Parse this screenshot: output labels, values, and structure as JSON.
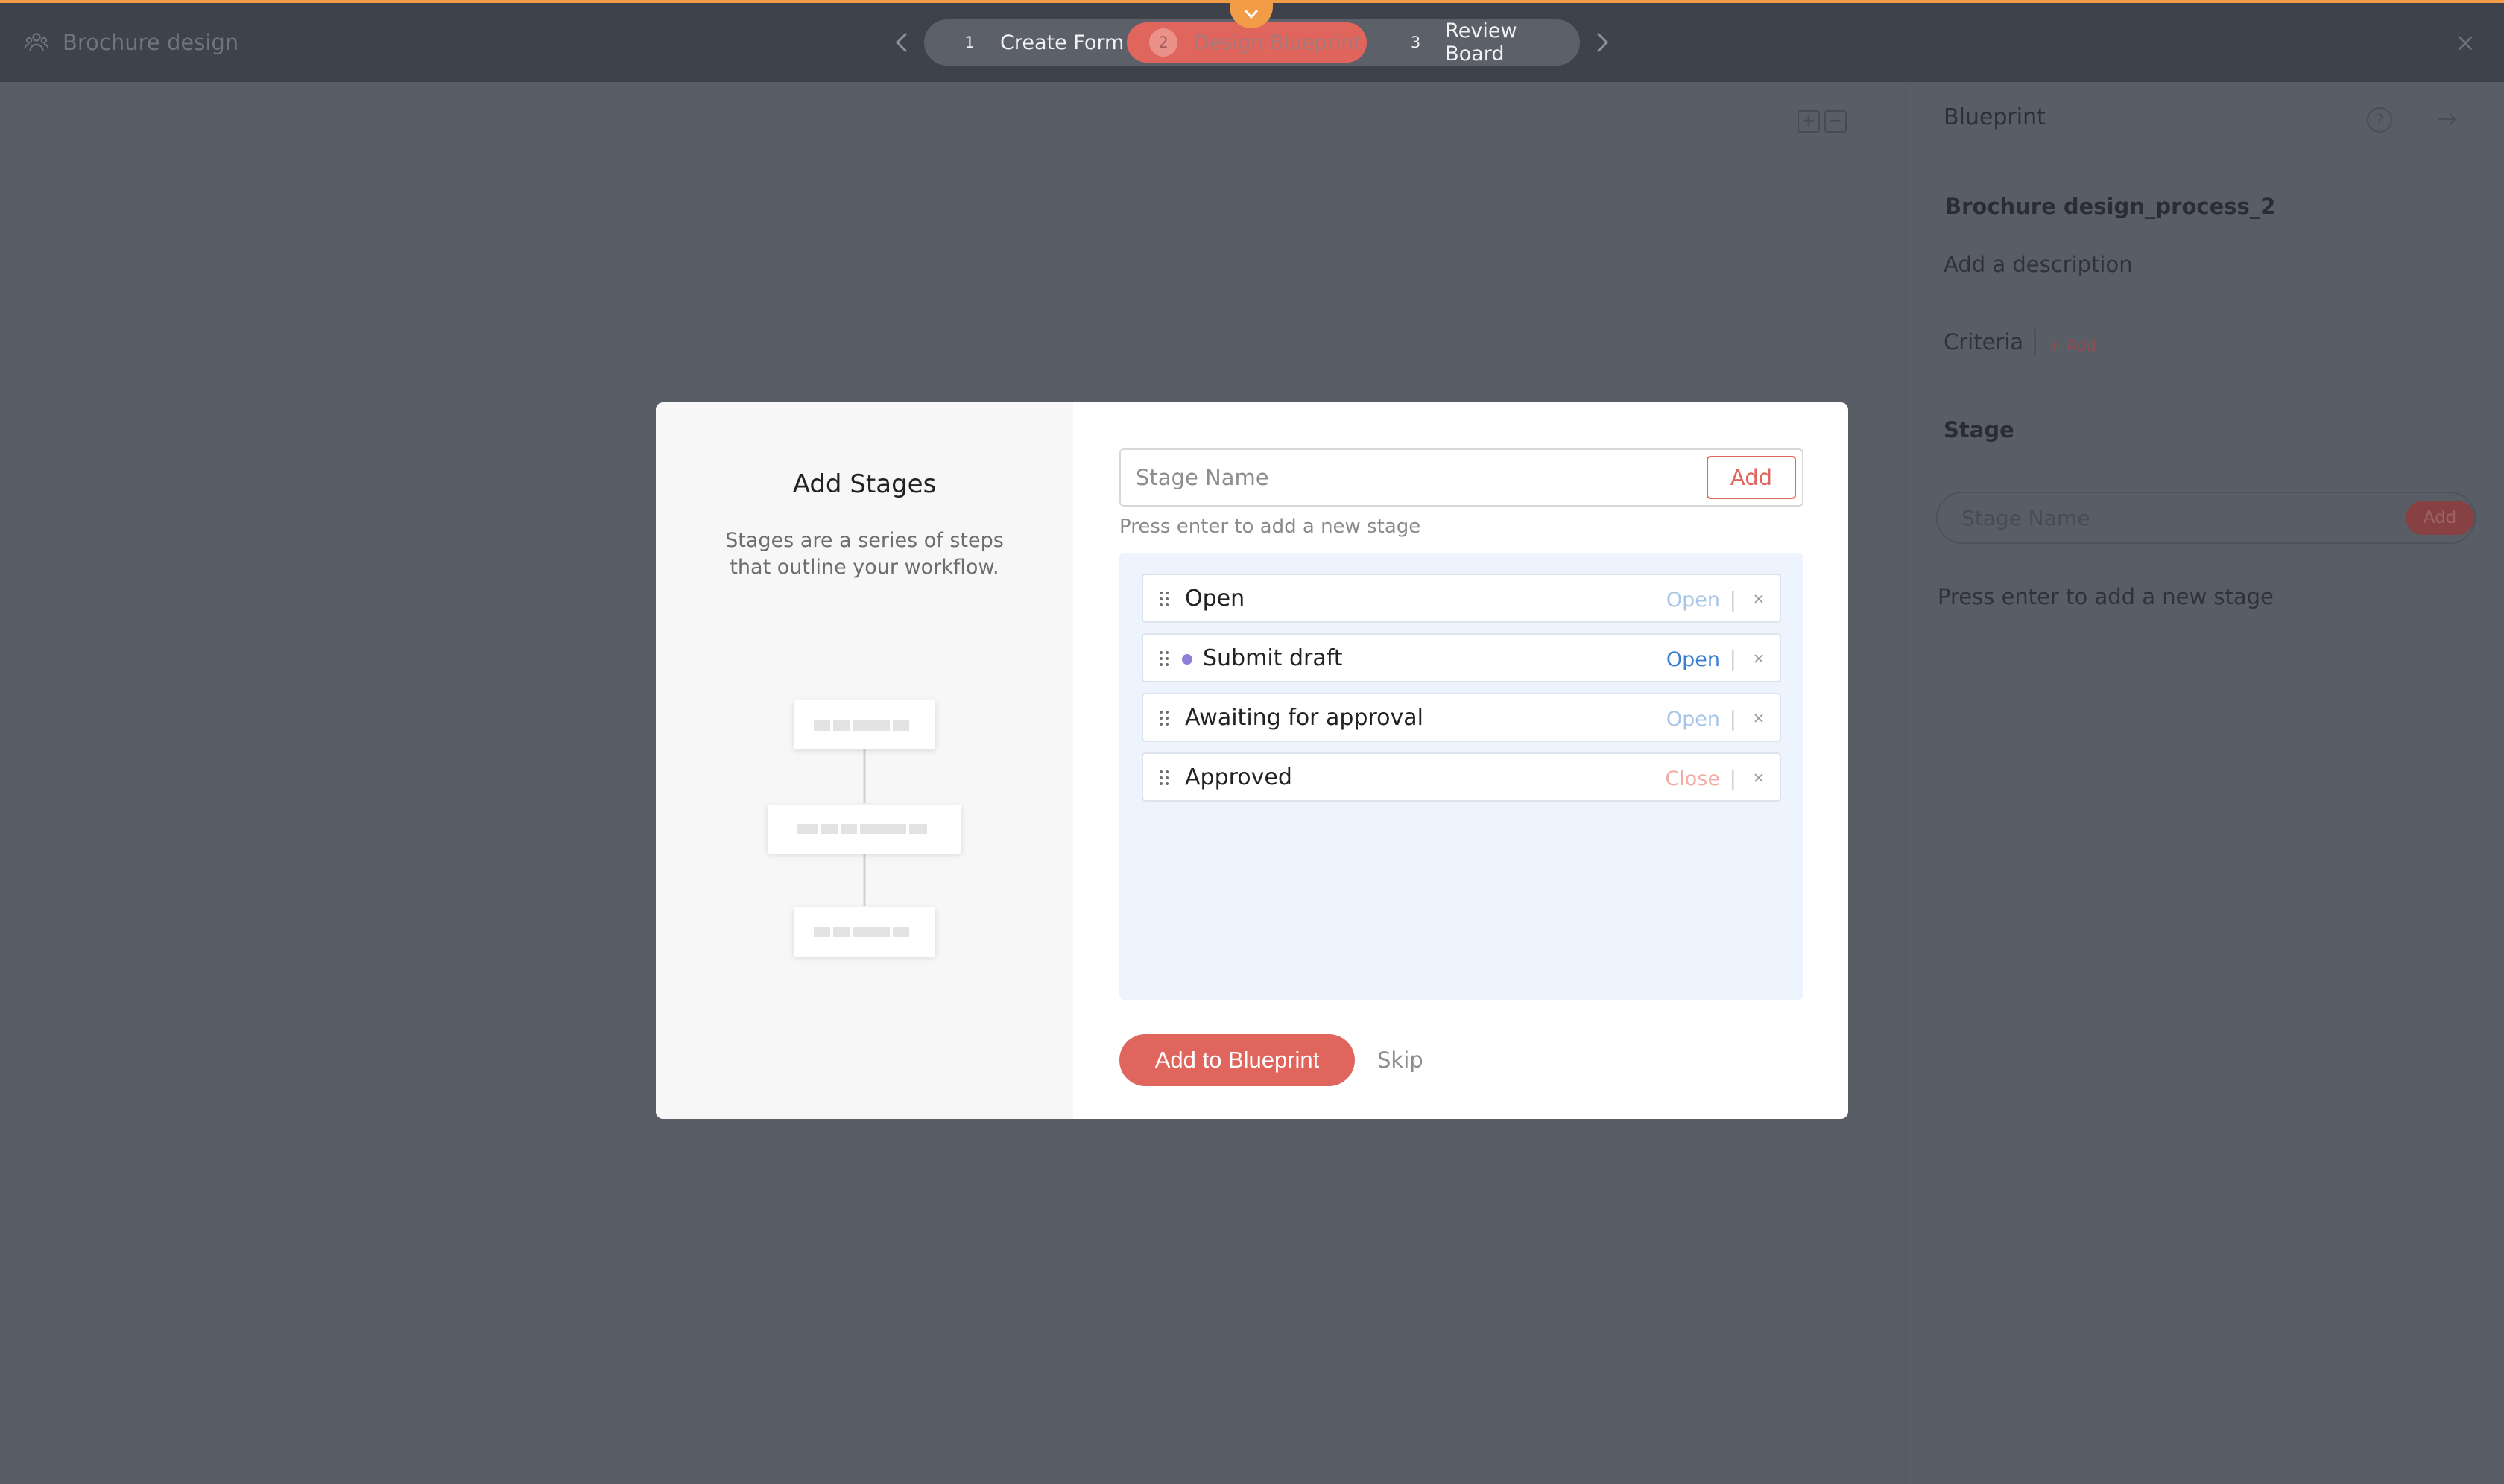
{
  "header": {
    "app_title": "Brochure design",
    "steps": [
      {
        "num": "1",
        "label": "Create Form"
      },
      {
        "num": "2",
        "label": "Design Blueprint"
      },
      {
        "num": "3",
        "label": "Review Board"
      }
    ]
  },
  "right_panel": {
    "title": "Blueprint",
    "help_glyph": "?",
    "process_name": "Brochure design_process_2",
    "description_placeholder": "Add a description",
    "criteria_label": "Criteria",
    "criteria_add": "+ Add",
    "stage_label": "Stage",
    "stage_input_placeholder": "Stage Name",
    "add_label": "Add",
    "hint": "Press enter to add a new stage"
  },
  "modal": {
    "title": "Add Stages",
    "description": "Stages are a series of steps that outline your workflow.",
    "input_placeholder": "Stage Name",
    "add_button": "Add",
    "hint": "Press enter to add a new stage",
    "stages": [
      {
        "name": "Open",
        "type": "Open"
      },
      {
        "name": "Submit draft",
        "type": "Open"
      },
      {
        "name": "Awaiting for approval",
        "type": "Open"
      },
      {
        "name": "Approved",
        "type": "Close"
      }
    ],
    "primary_button": "Add to Blueprint",
    "skip_label": "Skip"
  },
  "colors": {
    "accent": "#e0655c",
    "top_indicator": "#f39c48",
    "open_link": "#3b7fd1",
    "stage_dot": "#8c7fd8"
  }
}
